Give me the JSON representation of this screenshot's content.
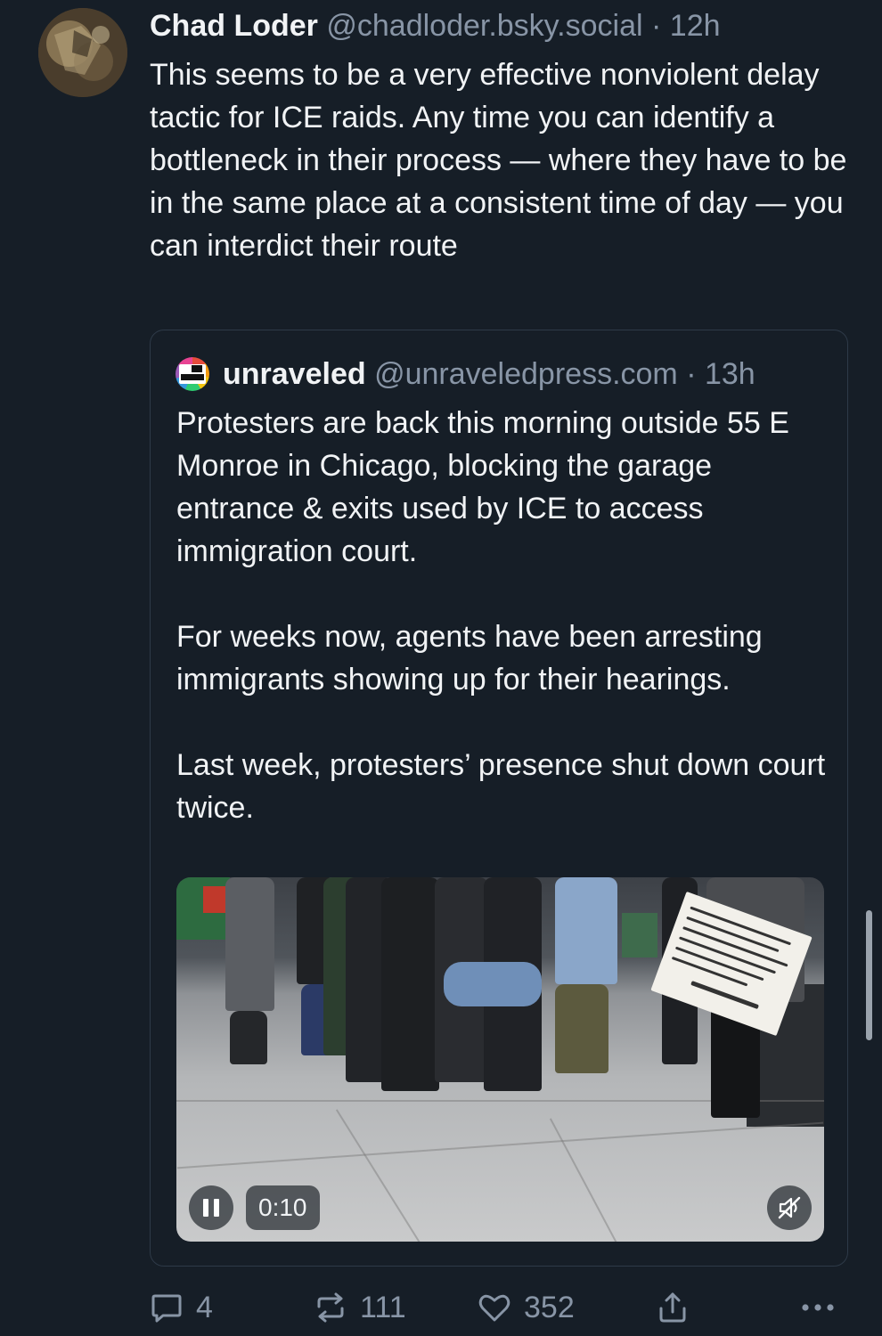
{
  "post": {
    "author": {
      "display_name": "Chad Loder",
      "handle": "@chadloder.bsky.social",
      "timestamp": "12h"
    },
    "text": "This seems to be a very effective nonviolent delay tactic for ICE raids. Any time you can identify a bottleneck in their process — where they have to be in the same place at a consistent time of day — you can interdict their route",
    "quote": {
      "author": {
        "display_name": "unraveled",
        "handle": "@unraveledpress.com",
        "timestamp": "13h"
      },
      "paragraphs": [
        "Protesters are back this morning outside 55 E Monroe in Chicago, blocking the garage entrance & exits used by ICE to access immigration court.",
        "For weeks now, agents have been arresting immigrants showing up for their hearings.",
        "Last week, protesters’ presence shut down court twice."
      ],
      "video": {
        "elapsed": "0:10",
        "playing": true,
        "muted": true
      }
    },
    "actions": {
      "reply_count": "4",
      "repost_count": "111",
      "like_count": "352"
    }
  },
  "icons": {
    "reply": "reply-icon",
    "repost": "repost-icon",
    "like": "heart-icon",
    "share": "share-icon",
    "more": "more-icon",
    "pause": "pause-icon",
    "mute": "muted-speaker-icon"
  },
  "colors": {
    "background": "#161e27",
    "text": "#f1f3f5",
    "muted_text": "#8895a6",
    "border": "#2e3a48"
  }
}
